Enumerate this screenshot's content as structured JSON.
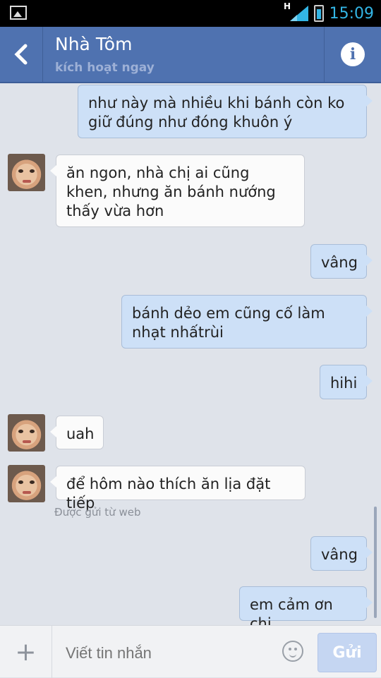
{
  "status_bar": {
    "time": "15:09",
    "network": "H",
    "icons": [
      "image-icon",
      "signal-icon",
      "battery-icon"
    ]
  },
  "header": {
    "title": "Nhà Tôm",
    "subtitle": "kích hoạt ngay",
    "icons": [
      "back-icon",
      "info-icon"
    ],
    "colors": {
      "bar": "#4f72b0",
      "outgoing_bubble": "#cde0f7",
      "incoming_bubble": "#fbfbfb"
    }
  },
  "messages": [
    {
      "direction": "outgoing",
      "text": "như này mà nhiều khi bánh còn ko giữ đúng như đóng khuôn ý"
    },
    {
      "direction": "incoming",
      "text": "ăn ngon, nhà chị ai cũng khen, nhưng ăn bánh nướng thấy vừa hơn"
    },
    {
      "direction": "outgoing",
      "text": "vâng"
    },
    {
      "direction": "outgoing",
      "text": "bánh dẻo em cũng cố làm nhạt nhấtrùi"
    },
    {
      "direction": "outgoing",
      "text": "hihi"
    },
    {
      "direction": "incoming",
      "text": "uah"
    },
    {
      "direction": "incoming",
      "text": "để hôm nào thích ăn lịa đặt tiếp",
      "sent_note": "Được gửi từ web"
    },
    {
      "direction": "outgoing",
      "text": "vâng"
    },
    {
      "direction": "outgoing",
      "text": "em cảm ơn chị"
    }
  ],
  "composer": {
    "placeholder": "Viết tin nhắn",
    "send_label": "Gửi",
    "icons": [
      "plus-icon",
      "emoji-icon"
    ]
  }
}
